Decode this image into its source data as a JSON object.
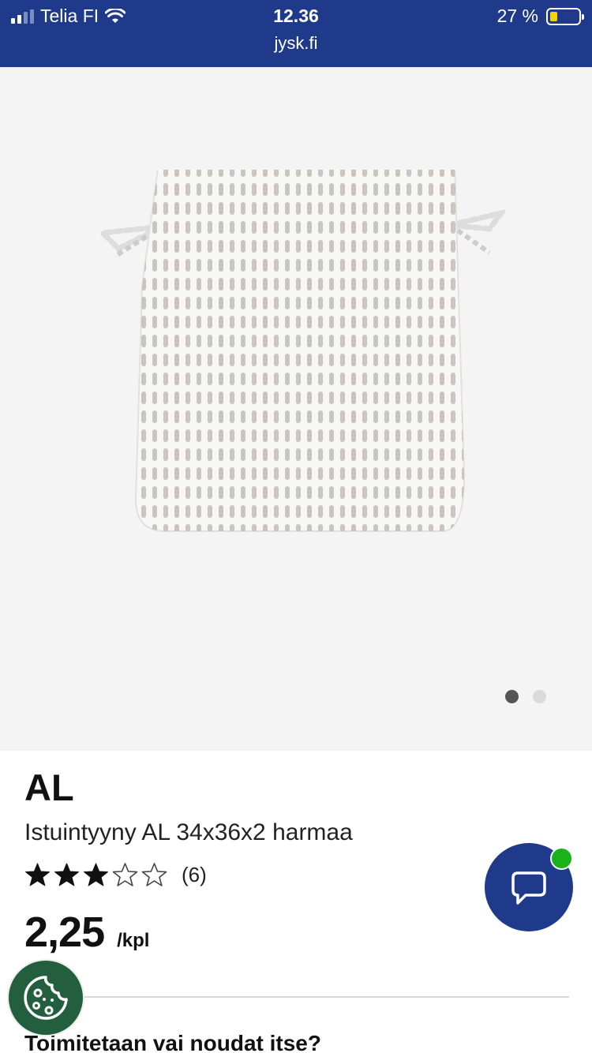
{
  "status_bar": {
    "carrier": "Telia FI",
    "time": "12.36",
    "url": "jysk.fi",
    "battery": "27 %",
    "battery_level": 0.27
  },
  "gallery": {
    "image_icon": "seat-cushion-product-image",
    "image_count": 2,
    "active_index": 0
  },
  "product": {
    "brand": "AL",
    "title": "Istuintyyny AL 34x36x2 harmaa",
    "rating_stars": 3,
    "rating_max": 5,
    "review_count": "(6)",
    "price": "2,25",
    "unit": "/kpl"
  },
  "delivery": {
    "heading": "Toimitetaan vai noudat itse?"
  },
  "floating": {
    "chat_icon": "chat-bubble-icon",
    "cookie_icon": "cookie-icon",
    "online_color": "#1ab21a"
  },
  "colors": {
    "brand_blue": "#1f3a8a",
    "cookie_green": "#235e3e"
  }
}
